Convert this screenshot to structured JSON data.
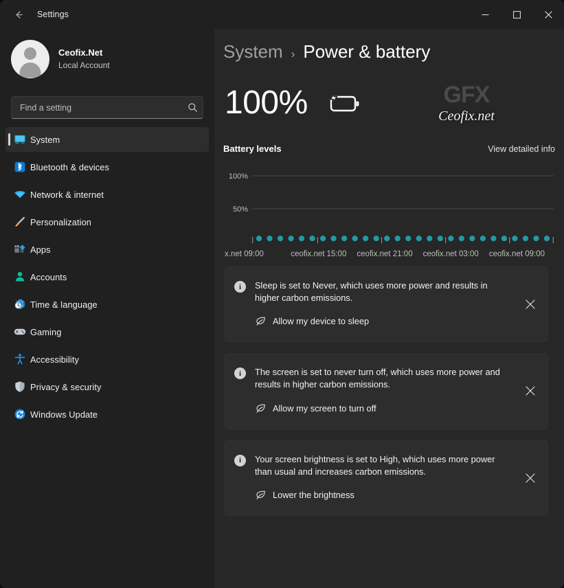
{
  "window": {
    "title": "Settings",
    "back_icon": "back-arrow-icon",
    "minimize_label": "–",
    "maximize_label": "□",
    "close_label": "✕"
  },
  "sidebar": {
    "account": {
      "name": "Ceofix.Net",
      "subtitle": "Local Account",
      "avatar_icon": "user-avatar-icon"
    },
    "search": {
      "placeholder": "Find a setting",
      "value": "",
      "icon": "search-icon"
    },
    "items": [
      {
        "label": "System",
        "icon": "monitor-icon",
        "selected": true
      },
      {
        "label": "Bluetooth & devices",
        "icon": "bluetooth-icon",
        "selected": false
      },
      {
        "label": "Network & internet",
        "icon": "wifi-icon",
        "selected": false
      },
      {
        "label": "Personalization",
        "icon": "paintbrush-icon",
        "selected": false
      },
      {
        "label": "Apps",
        "icon": "apps-icon",
        "selected": false
      },
      {
        "label": "Accounts",
        "icon": "person-icon",
        "selected": false
      },
      {
        "label": "Time & language",
        "icon": "clock-globe-icon",
        "selected": false
      },
      {
        "label": "Gaming",
        "icon": "gamepad-icon",
        "selected": false
      },
      {
        "label": "Accessibility",
        "icon": "accessibility-icon",
        "selected": false
      },
      {
        "label": "Privacy & security",
        "icon": "shield-icon",
        "selected": false
      },
      {
        "label": "Windows Update",
        "icon": "update-icon",
        "selected": false
      }
    ]
  },
  "main": {
    "breadcrumb": {
      "parent": "System",
      "separator": "›",
      "current": "Power & battery"
    },
    "battery": {
      "percent_label": "100%",
      "icon": "battery-charging-icon"
    },
    "watermark": {
      "logo_text": "GFX",
      "site_text": "Ceofix.net"
    },
    "chart_section": {
      "title": "Battery levels",
      "link_label": "View detailed info"
    },
    "cards": [
      {
        "info_icon": "info-icon",
        "message": "Sleep is set to Never, which uses more power and results in higher carbon emissions.",
        "action_label": "Allow my device to sleep",
        "action_icon": "eco-leaf-icon",
        "close_icon": "close-icon"
      },
      {
        "info_icon": "info-icon",
        "message": "The screen is set to never turn off, which uses more power and results in higher carbon emissions.",
        "action_label": "Allow my screen to turn off",
        "action_icon": "eco-leaf-icon",
        "close_icon": "close-icon"
      },
      {
        "info_icon": "info-icon",
        "message": "Your screen brightness is set to High, which uses more power than usual and increases carbon emissions.",
        "action_label": "Lower the brightness",
        "action_icon": "eco-leaf-icon",
        "close_icon": "close-icon"
      }
    ]
  },
  "colors": {
    "accent_teal": "#1f9bab",
    "window_bg": "#202020",
    "main_bg": "#272727",
    "card_bg": "#2d2d2d",
    "gridline": "#4a4a4a"
  },
  "chart_data": {
    "type": "scatter",
    "title": "Battery levels",
    "xlabel": "",
    "ylabel": "",
    "ylim": [
      0,
      100
    ],
    "yticks": [
      50,
      100
    ],
    "ytick_labels": [
      "50%",
      "100%"
    ],
    "grid": true,
    "legend": false,
    "xtick_labels": [
      "x.net 09:00",
      "ceofix.net 15:00",
      "ceofix.net 21:00",
      "ceofix.net 03:00",
      "ceofix.net 09:00"
    ],
    "point_color": "#1f9bab",
    "x": [
      0,
      1,
      2,
      3,
      4,
      5,
      6,
      7,
      8,
      9,
      10,
      11,
      12,
      13,
      14,
      15,
      16,
      17,
      18,
      19,
      20,
      21,
      22,
      23,
      24,
      25,
      26,
      27
    ],
    "values": [
      3,
      3,
      3,
      3,
      3,
      3,
      3,
      3,
      3,
      3,
      3,
      3,
      3,
      3,
      3,
      3,
      3,
      3,
      3,
      3,
      3,
      3,
      3,
      3,
      3,
      3,
      3,
      3
    ]
  }
}
